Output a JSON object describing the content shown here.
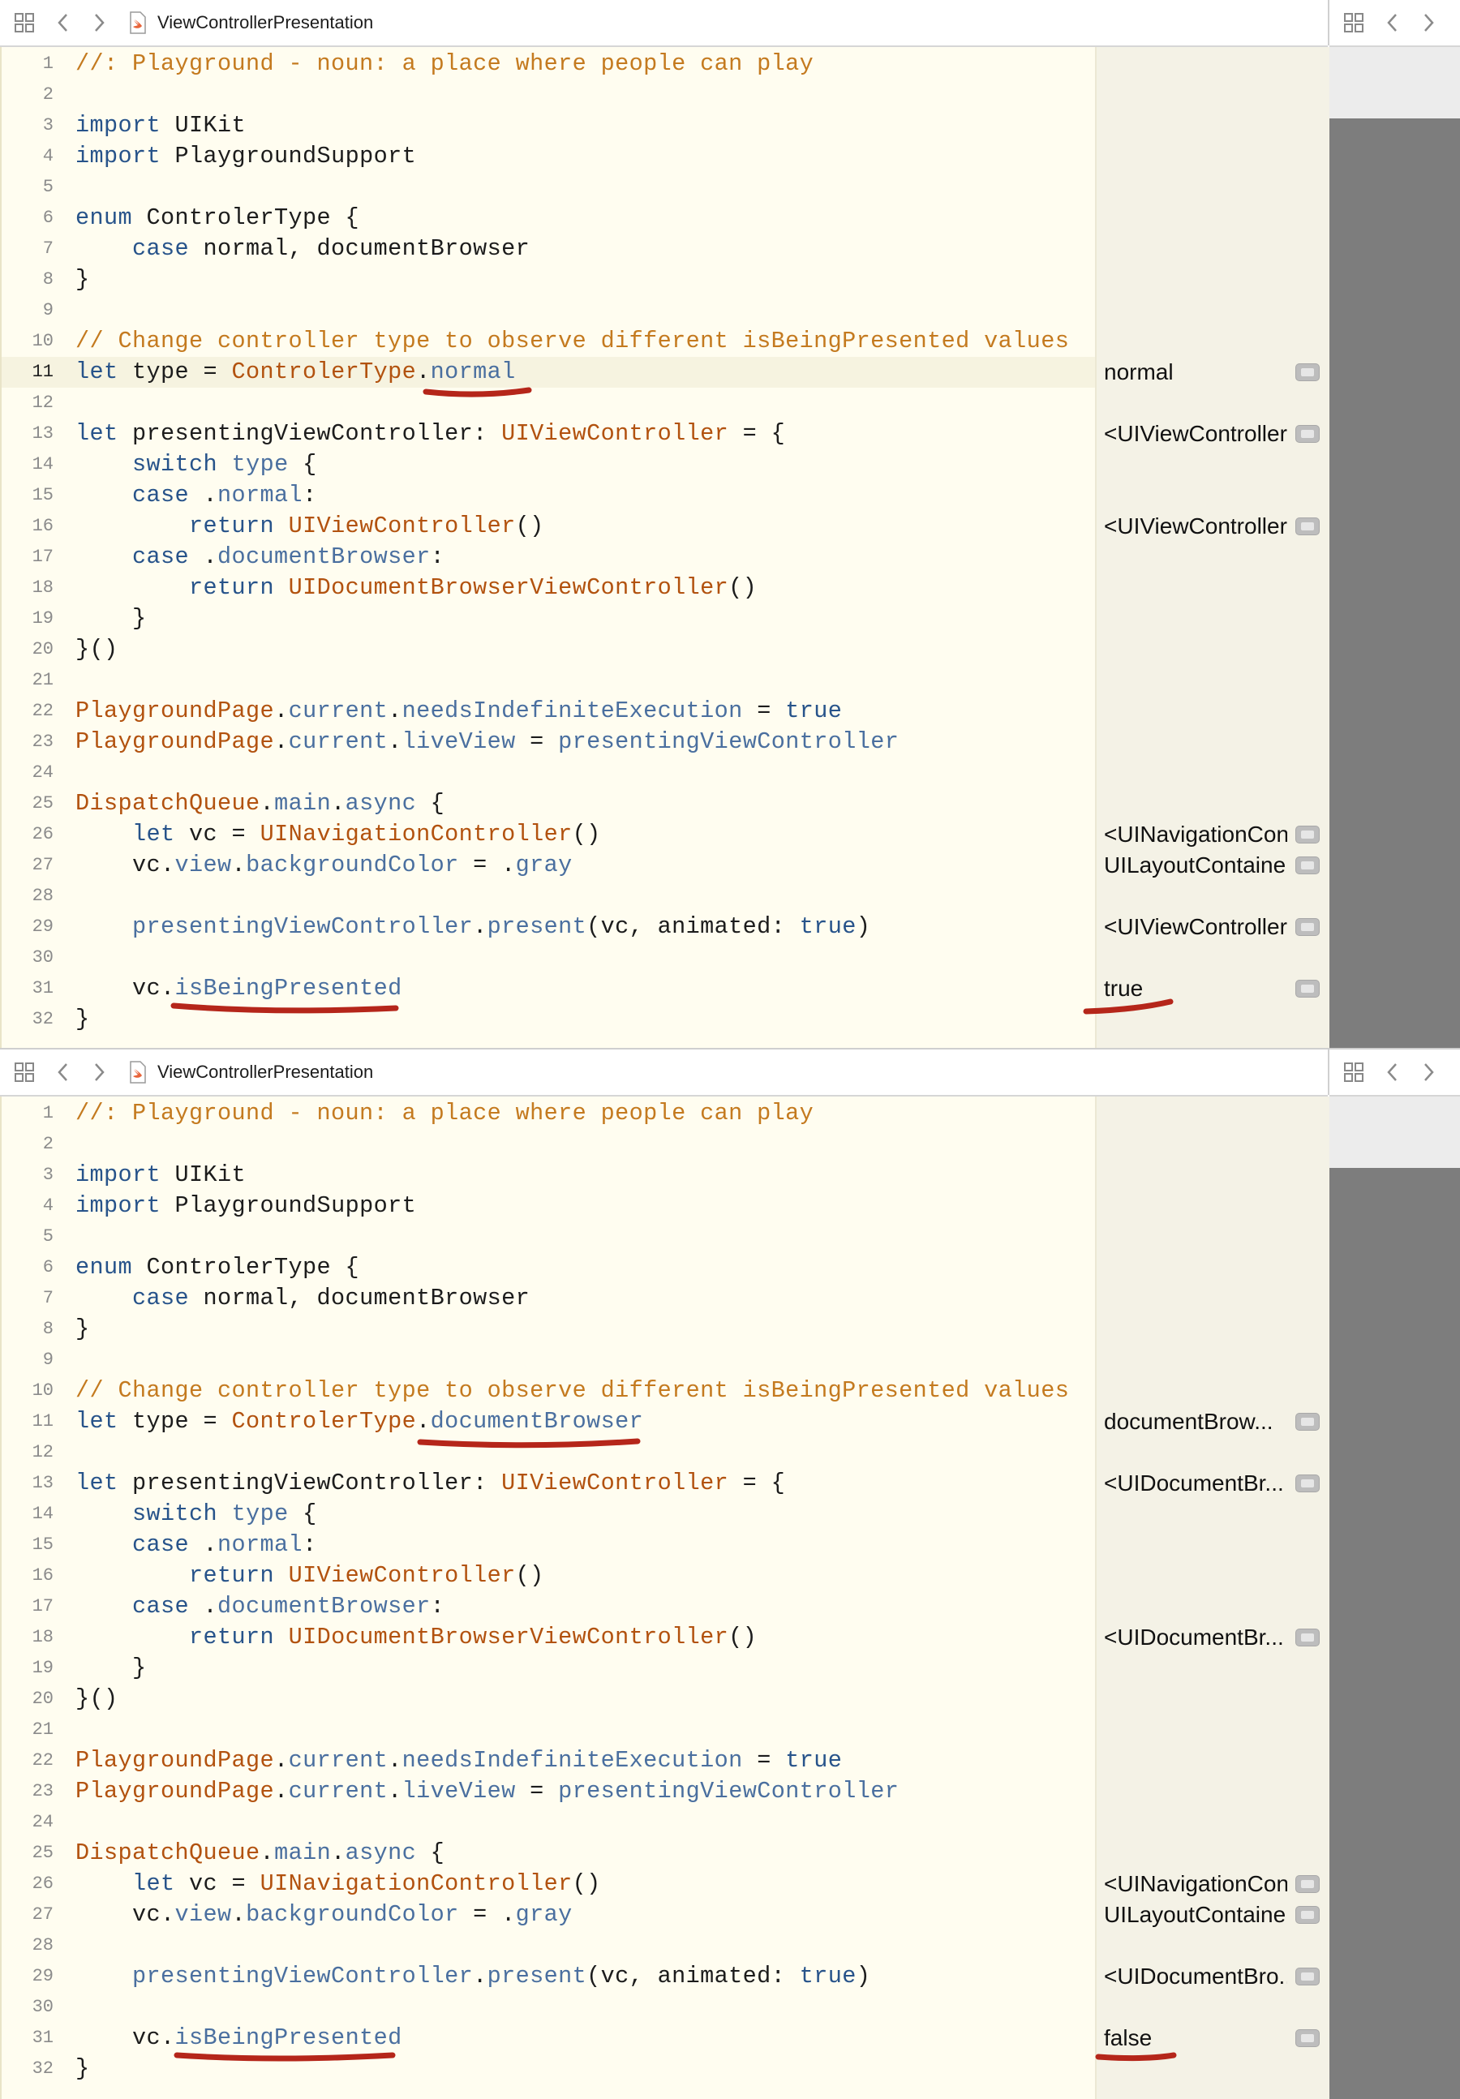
{
  "colors": {
    "keyword": "#27538a",
    "type": "#b2520f",
    "comment": "#c47a1f",
    "property": "#4a6f9f",
    "annotation": "#b5261a"
  },
  "panels": [
    {
      "title": "ViewControllerPresentation",
      "icons": [
        "grid-icon",
        "back-chevron-icon",
        "forward-chevron-icon",
        "swift-file-icon"
      ],
      "line_numbers": [
        "1",
        "2",
        "3",
        "4",
        "5",
        "6",
        "7",
        "8",
        "9",
        "10",
        "11",
        "12",
        "13",
        "14",
        "15",
        "16",
        "17",
        "18",
        "19",
        "20",
        "21",
        "22",
        "23",
        "24",
        "25",
        "26",
        "27",
        "28",
        "29",
        "30",
        "31",
        "32"
      ],
      "selected_case": "normal",
      "results": {
        "r11": "normal",
        "r13": "<UIViewController:",
        "r16": "<UIViewController:",
        "r26": "<UINavigationCon...",
        "r27": "UILayoutContainer...",
        "r29": "<UIViewController:",
        "r31": "true"
      }
    },
    {
      "title": "ViewControllerPresentation",
      "icons": [
        "grid-icon",
        "back-chevron-icon",
        "forward-chevron-icon",
        "swift-file-icon"
      ],
      "line_numbers": [
        "1",
        "2",
        "3",
        "4",
        "5",
        "6",
        "7",
        "8",
        "9",
        "10",
        "11",
        "12",
        "13",
        "14",
        "15",
        "16",
        "17",
        "18",
        "19",
        "20",
        "21",
        "22",
        "23",
        "24",
        "25",
        "26",
        "27",
        "28",
        "29",
        "30",
        "31",
        "32"
      ],
      "selected_case": "documentBrowser",
      "results": {
        "r11": "documentBrow...",
        "r13": "<UIDocumentBr...",
        "r18": "<UIDocumentBr...",
        "r26": "<UINavigationCon...",
        "r27": "UILayoutContainer...",
        "r29": "<UIDocumentBro...",
        "r31": "false"
      }
    }
  ],
  "code": {
    "l1": "//: Playground - noun: a place where people can play",
    "l3_kw": "import",
    "l3_id": " UIKit",
    "l4_kw": "import",
    "l4_id": " PlaygroundSupport",
    "l6_kw": "enum",
    "l6_id": " ControlerType {",
    "l7_ind": "    ",
    "l7_kw": "case",
    "l7_id": " normal, documentBrowser",
    "l8": "}",
    "l10": "// Change controller type to observe different isBeingPresented values",
    "l11_kw": "let",
    "l11_a": " type = ",
    "l11_t": "ControlerType",
    "l11_dot": ".",
    "l13_kw": "let",
    "l13_a": " presentingViewController: ",
    "l13_t": "UIViewController",
    "l13_b": " = {",
    "l14_ind": "    ",
    "l14_kw": "switch",
    "l14_sp": " ",
    "l14_p": "type",
    "l14_b": " {",
    "l15_ind": "    ",
    "l15_kw": "case",
    "l15_a": " .",
    "l15_p": "normal",
    "l15_b": ":",
    "l16_ind": "        ",
    "l16_kw": "return",
    "l16_sp": " ",
    "l16_t": "UIViewController",
    "l16_b": "()",
    "l17_ind": "    ",
    "l17_kw": "case",
    "l17_a": " .",
    "l17_p": "documentBrowser",
    "l17_b": ":",
    "l18_ind": "        ",
    "l18_kw": "return",
    "l18_sp": " ",
    "l18_t": "UIDocumentBrowserViewController",
    "l18_b": "()",
    "l19": "    }",
    "l20": "}()",
    "l22_t": "PlaygroundPage",
    "l22_d1": ".",
    "l22_p1": "current",
    "l22_d2": ".",
    "l22_p2": "needsIndefiniteExecution",
    "l22_eq": " = ",
    "l22_kw": "true",
    "l23_t": "PlaygroundPage",
    "l23_d1": ".",
    "l23_p1": "current",
    "l23_d2": ".",
    "l23_p2": "liveView",
    "l23_eq": " = ",
    "l23_p3": "presentingViewController",
    "l25_t": "DispatchQueue",
    "l25_d1": ".",
    "l25_p1": "main",
    "l25_d2": ".",
    "l25_p2": "async",
    "l25_b": " {",
    "l26_ind": "    ",
    "l26_kw": "let",
    "l26_a": " vc = ",
    "l26_t": "UINavigationController",
    "l26_b": "()",
    "l27_ind": "    ",
    "l27_a": "vc.",
    "l27_p1": "view",
    "l27_d": ".",
    "l27_p2": "backgroundColor",
    "l27_b": " = .",
    "l27_p3": "gray",
    "l29_ind": "    ",
    "l29_p1": "presentingViewController",
    "l29_d": ".",
    "l29_p2": "present",
    "l29_a": "(vc, animated: ",
    "l29_kw": "true",
    "l29_b": ")",
    "l31_ind": "    ",
    "l31_a": "vc.",
    "l31_p": "isBeingPresented",
    "l32": "}"
  }
}
